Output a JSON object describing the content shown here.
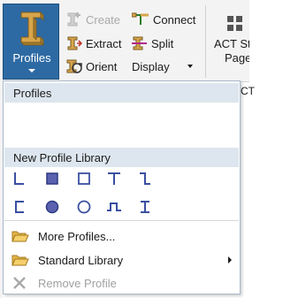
{
  "ribbon": {
    "profiles_label": "Profiles",
    "create_label": "Create",
    "extract_label": "Extract",
    "orient_label": "Orient",
    "connect_label": "Connect",
    "split_label": "Split",
    "display_label": "Display",
    "act_label_line1": "ACT St",
    "act_label_line2": "Page",
    "peek_text": "CT"
  },
  "menu": {
    "profiles_header": "Profiles",
    "library_header": "New Profile Library",
    "shapes_row1": [
      "angle-shape-icon",
      "solid-rectangle-shape-icon",
      "hollow-rectangle-shape-icon",
      "tee-shape-icon",
      "z-shape-icon"
    ],
    "shapes_row2": [
      "channel-shape-icon",
      "solid-circle-shape-icon",
      "hollow-circle-shape-icon",
      "hat-shape-icon",
      "i-beam-shape-icon"
    ],
    "more_profiles": "More Profiles...",
    "standard_library": "Standard Library",
    "remove_profile": "Remove Profile"
  },
  "colors": {
    "accent": "#2d6aa3",
    "header_bg": "#dde6ee",
    "shape_blue": "#3a4fa0"
  }
}
